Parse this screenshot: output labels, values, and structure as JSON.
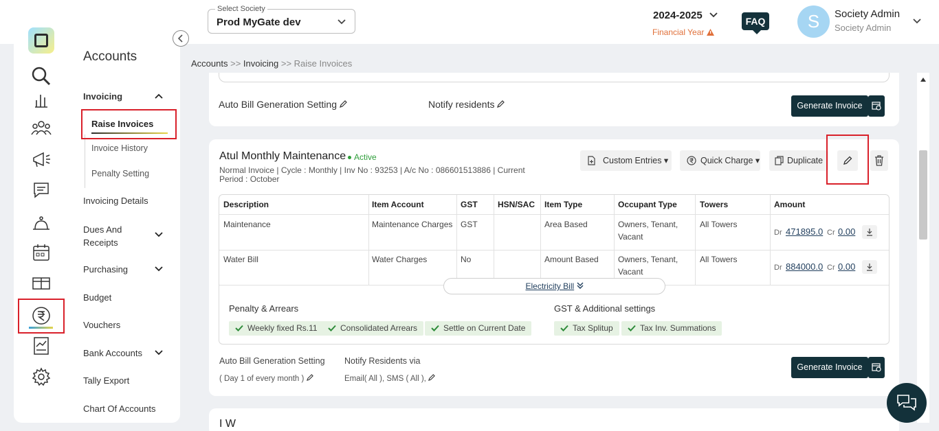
{
  "header": {
    "society_label": "Select Society",
    "society_value": "Prod MyGate dev",
    "financial_year": "2024-2025",
    "financial_year_label": "Financial Year",
    "faq": "FAQ",
    "avatar_letter": "S",
    "user_name": "Society Admin",
    "user_role": "Society Admin"
  },
  "sidebar": {
    "title": "Accounts",
    "invoicing": "Invoicing",
    "invoicing_sub": [
      "Raise Invoices",
      "Invoice History",
      "Penalty Setting"
    ],
    "items": [
      "Invoicing Details",
      "Dues And Receipts",
      "Purchasing",
      "Budget",
      "Vouchers",
      "Bank Accounts",
      "Tally Export",
      "Chart Of Accounts"
    ],
    "rail_icons": [
      "search-icon",
      "chart-bar-icon",
      "people-icon",
      "megaphone-icon",
      "chat-icon",
      "service-icon",
      "calendar-icon",
      "gift-icon",
      "rupee-icon",
      "report-icon",
      "settings-icon"
    ]
  },
  "breadcrumb": {
    "accounts": "Accounts",
    "sep1": ">>",
    "invoicing": "Invoicing",
    "sep2": ">>",
    "current": "Raise Invoices"
  },
  "top_card": {
    "auto_bill": "Auto Bill Generation Setting",
    "notify": "Notify residents",
    "generate": "Generate Invoice"
  },
  "invoice_card": {
    "title": "Atul Monthly Maintenance",
    "status": "Active",
    "meta": "Normal Invoice | Cycle : Monthly | Inv No : 93253 | A/c No : 086601513886 | Current Period : October",
    "buttons": {
      "custom_entries": "Custom Entries",
      "quick_charge": "Quick Charge",
      "duplicate": "Duplicate"
    },
    "table": {
      "headers": [
        "Description",
        "Item Account",
        "GST",
        "HSN/SAC",
        "Item Type",
        "Occupant Type",
        "Towers",
        "Amount"
      ],
      "rows": [
        {
          "description": "Maintenance",
          "account": "Maintenance Charges",
          "gst": "GST",
          "hsn": "",
          "type": "Area Based",
          "occupant1": "Owners, Tenant,",
          "occupant2": "Vacant",
          "towers": "All Towers",
          "dr_label": "Dr",
          "dr": "471895.0",
          "cr_label": "Cr",
          "cr": "0.00"
        },
        {
          "description": "Water Bill",
          "account": "Water Charges",
          "gst": "No",
          "hsn": "",
          "type": "Amount Based",
          "occupant1": "Owners, Tenant,",
          "occupant2": "Vacant",
          "towers": "All Towers",
          "dr_label": "Dr",
          "dr": "884000.0",
          "cr_label": "Cr",
          "cr": "0.00"
        }
      ],
      "more": "Electricity Bill"
    },
    "penalty_title": "Penalty & Arrears",
    "penalty_chips": [
      "Weekly fixed Rs.11",
      "Consolidated Arrears",
      "Settle on Current Date"
    ],
    "gst_title": "GST & Additional settings",
    "gst_chips": [
      "Tax Splitup",
      "Tax Inv. Summations"
    ],
    "auto_bill_label": "Auto Bill Generation Setting",
    "auto_bill_value": "( Day 1 of every month )",
    "notify_label": "Notify Residents via",
    "notify_value": "Email( All ), SMS ( All ),",
    "generate": "Generate Invoice"
  },
  "next_card_title": "I  W"
}
